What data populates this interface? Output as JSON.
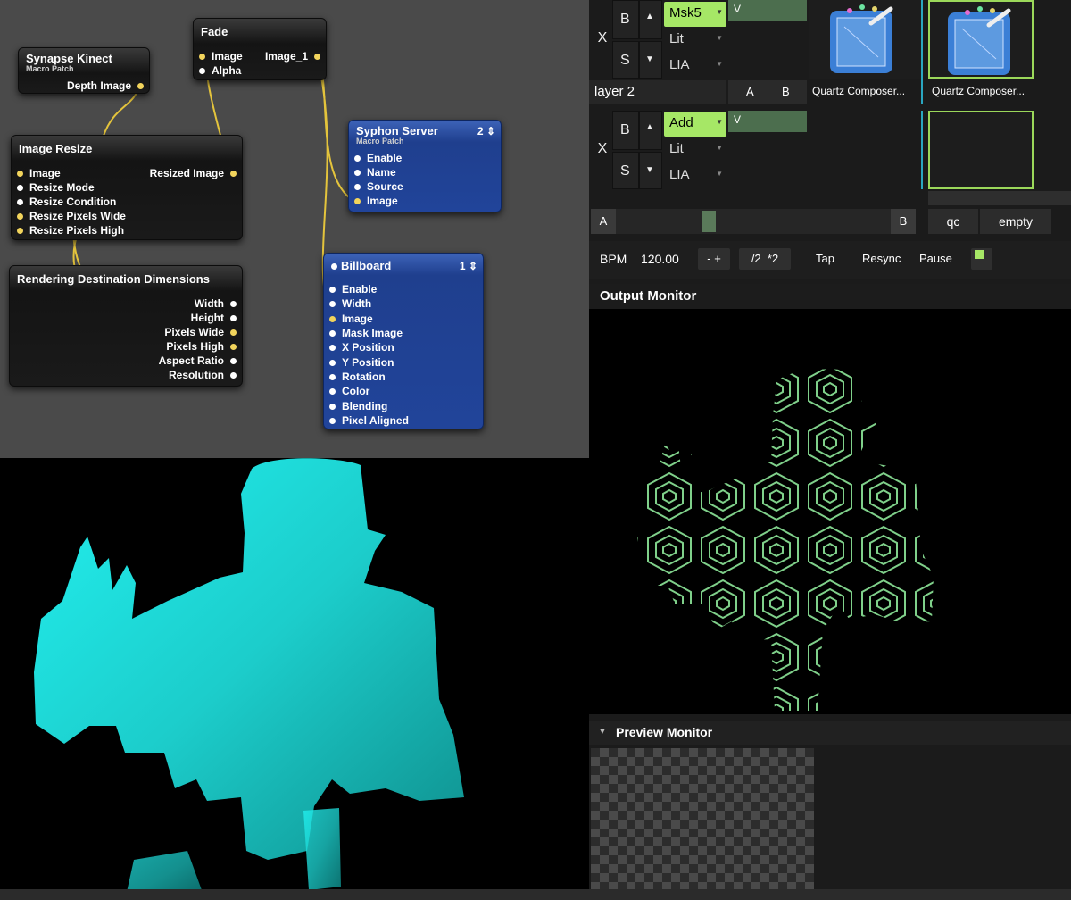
{
  "qc_editor": {
    "patches": {
      "synapse": {
        "title": "Synapse Kinect",
        "subtitle": "Macro Patch",
        "outputs": [
          "Depth Image"
        ]
      },
      "fade": {
        "title": "Fade",
        "inputs": [
          "Image",
          "Alpha"
        ],
        "outputs": [
          "Image_1"
        ]
      },
      "syphon": {
        "title": "Syphon Server",
        "subtitle": "Macro Patch",
        "count": "2",
        "inputs": [
          "Enable",
          "Name",
          "Source",
          "Image"
        ]
      },
      "resize": {
        "title": "Image Resize",
        "inputs": [
          "Image",
          "Resize Mode",
          "Resize Condition",
          "Resize Pixels Wide",
          "Resize Pixels High"
        ],
        "outputs": [
          "Resized Image"
        ]
      },
      "rdd": {
        "title": "Rendering Destination Dimensions",
        "outputs": [
          "Width",
          "Height",
          "Pixels Wide",
          "Pixels High",
          "Aspect Ratio",
          "Resolution"
        ]
      },
      "billboard": {
        "title": "Billboard",
        "count": "1",
        "inputs": [
          "Enable",
          "Width",
          "Image",
          "Mask Image",
          "X Position",
          "Y Position",
          "Rotation",
          "Color",
          "Blending",
          "Pixel Aligned"
        ]
      }
    }
  },
  "vj_app": {
    "layer1": {
      "x": "X",
      "b": "B",
      "s": "S",
      "up": "▲",
      "down": "▼",
      "modes": [
        {
          "label": "Msk5",
          "active": true
        },
        {
          "label": "Lit",
          "active": false
        },
        {
          "label": "LIA",
          "active": false
        }
      ],
      "v": "V",
      "name": "layer 2",
      "ab_a": "A",
      "ab_b": "B",
      "clips": [
        "Quartz Composer...",
        "Quartz Composer..."
      ]
    },
    "layer2": {
      "x": "X",
      "b": "B",
      "s": "S",
      "up": "▲",
      "down": "▼",
      "modes": [
        {
          "label": "Add",
          "active": true
        },
        {
          "label": "Lit",
          "active": false
        },
        {
          "label": "LIA",
          "active": false
        }
      ],
      "v": "V"
    },
    "crossfader": {
      "a": "A",
      "b": "B",
      "value": 0.33
    },
    "tabs": [
      "qc",
      "empty"
    ],
    "bpm": {
      "label": "BPM",
      "value": "120.00",
      "minus": "-",
      "plus": "+",
      "half": "/2",
      "double": "*2",
      "tap": "Tap",
      "resync": "Resync",
      "pause": "Pause"
    },
    "output_monitor": {
      "title": "Output Monitor"
    },
    "preview_monitor": {
      "title": "Preview Monitor"
    }
  },
  "colors": {
    "accent_green": "#a6e766",
    "depth_cyan": "#1ad3d0",
    "pattern_green": "#7fd08a",
    "node_blue": "#2a4ea6"
  }
}
